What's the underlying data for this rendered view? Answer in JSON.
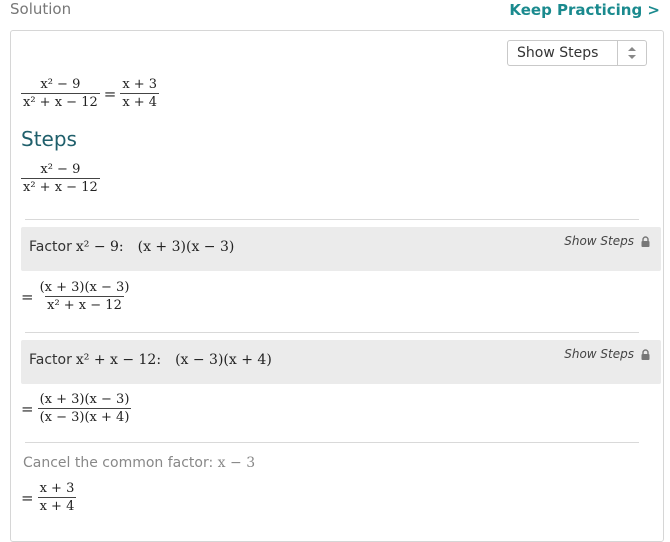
{
  "header": {
    "title": "Solution",
    "keep_practicing": "Keep Practicing >"
  },
  "select": {
    "label": "Show Steps"
  },
  "result": {
    "lhs_num": "x² − 9",
    "lhs_den": "x² + x − 12",
    "equals": "=",
    "rhs_num": "x + 3",
    "rhs_den": "x + 4"
  },
  "steps_heading": "Steps",
  "steps_expr": {
    "num": "x² − 9",
    "den": "x² + x − 12"
  },
  "step1": {
    "prefix": "Factor",
    "expr": "x² − 9:",
    "result": "(x + 3)(x − 3)",
    "show": "Show Steps",
    "eq": "=",
    "out_num": "(x + 3)(x − 3)",
    "out_den": "x² + x − 12"
  },
  "step2": {
    "prefix": "Factor",
    "expr": "x² + x − 12:",
    "result": "(x − 3)(x + 4)",
    "show": "Show Steps",
    "eq": "=",
    "out_num": "(x + 3)(x − 3)",
    "out_den": "(x − 3)(x + 4)"
  },
  "step3": {
    "text": "Cancel the common factor:",
    "expr": "x − 3",
    "eq": "=",
    "out_num": "x + 3",
    "out_den": "x + 4"
  },
  "colors": {
    "accent": "#1a8a8e",
    "heading": "#1f5f6b",
    "stepbox": "#ebebeb"
  },
  "icons": {
    "lock": "lock-icon",
    "select_arrows": "up-down-arrows-icon"
  }
}
